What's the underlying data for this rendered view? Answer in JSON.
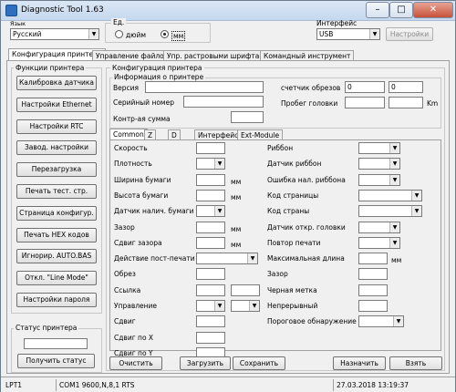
{
  "window": {
    "title": "Diagnostic Tool 1.63",
    "minimize": "–",
    "maximize": "□",
    "close": "✕"
  },
  "language": {
    "label": "Язык",
    "value": "Русский"
  },
  "units": {
    "label": "Ед.",
    "inch": "дюйм",
    "mm": "мм",
    "selected": "мм"
  },
  "interface": {
    "label": "Интерфейс",
    "value": "USB",
    "settings_button": "Настройки"
  },
  "main_tabs": [
    "Конфигурация принтера",
    "Управление файлом",
    "Упр. растровыми шрифтами",
    "Командный инструмент"
  ],
  "functions": {
    "title": "Функции принтера",
    "buttons": [
      "Калибровка датчика",
      "Настройки Ethernet",
      "Настройки RTC",
      "Завод. настройки",
      "Перезагрузка",
      "Печать тест. стр.",
      "Страница конфигур.",
      "Печать HEX кодов",
      "Игнорир. AUTO.BAS",
      "Откл. \"Line Mode\"",
      "Настройки пароля"
    ]
  },
  "printer_status": {
    "title": "Статус принтера",
    "button": "Получить статус"
  },
  "config": {
    "title": "Конфигурация принтера",
    "info": {
      "title": "Информация о принтере",
      "version": "Версия",
      "serial": "Серийный номер",
      "checksum": "Контр-ая сумма",
      "cut_counter": "счетчик обрезов",
      "cut_value_1": "0",
      "cut_value_2": "0",
      "head_mileage": "Пробег головки",
      "km": "Km"
    },
    "sub_tabs": [
      "Common",
      "Z",
      "D",
      "Интерфейс",
      "Ext-Module"
    ],
    "left_fields": [
      {
        "label": "Скорость",
        "kind": "field",
        "unit": ""
      },
      {
        "label": "Плотность",
        "kind": "combo",
        "unit": ""
      },
      {
        "label": "Ширина бумаги",
        "kind": "field",
        "unit": "мм"
      },
      {
        "label": "Высота бумаги",
        "kind": "field",
        "unit": "мм"
      },
      {
        "label": "Датчик налич. бумаги",
        "kind": "combo",
        "unit": ""
      },
      {
        "label": "Зазор",
        "kind": "field",
        "unit": "мм"
      },
      {
        "label": "Сдвиг зазора",
        "kind": "field",
        "unit": "мм"
      },
      {
        "label": "Действие пост-печати",
        "kind": "combo",
        "unit": ""
      },
      {
        "label": "Обрез",
        "kind": "field",
        "unit": ""
      },
      {
        "label": "Ссылка",
        "kind": "field2",
        "unit": ""
      },
      {
        "label": "Управление",
        "kind": "combo2",
        "unit": ""
      },
      {
        "label": "Сдвиг",
        "kind": "field",
        "unit": ""
      },
      {
        "label": "Сдвиг по X",
        "kind": "field",
        "unit": ""
      },
      {
        "label": "Сдвиг по Y",
        "kind": "field",
        "unit": ""
      }
    ],
    "right_fields": [
      {
        "label": "Риббон",
        "kind": "combo",
        "unit": ""
      },
      {
        "label": "Датчик риббон",
        "kind": "combo",
        "unit": ""
      },
      {
        "label": "Ошибка нал. риббона",
        "kind": "combo",
        "unit": ""
      },
      {
        "label": "Код страницы",
        "kind": "combo",
        "unit": ""
      },
      {
        "label": "Код страны",
        "kind": "combo",
        "unit": ""
      },
      {
        "label": "Датчик откр. головки",
        "kind": "combo",
        "unit": ""
      },
      {
        "label": "Повтор печати",
        "kind": "combo",
        "unit": ""
      },
      {
        "label": "Максимальная длина",
        "kind": "field",
        "unit": "мм"
      },
      {
        "label": "Зазор",
        "kind": "field",
        "unit": ""
      },
      {
        "label": "Черная метка",
        "kind": "field",
        "unit": ""
      },
      {
        "label": "Непрерывный",
        "kind": "field",
        "unit": ""
      },
      {
        "label": "Пороговое обнаружение",
        "kind": "combo",
        "unit": ""
      }
    ],
    "buttons": {
      "clear": "Очистить",
      "load": "Загрузить",
      "save": "Сохранить",
      "assign": "Назначить",
      "take": "Взять"
    }
  },
  "statusbar": {
    "port": "LPT1",
    "com": "COM1 9600,N,8,1 RTS",
    "datetime": "27.03.2018 13:19:37"
  }
}
